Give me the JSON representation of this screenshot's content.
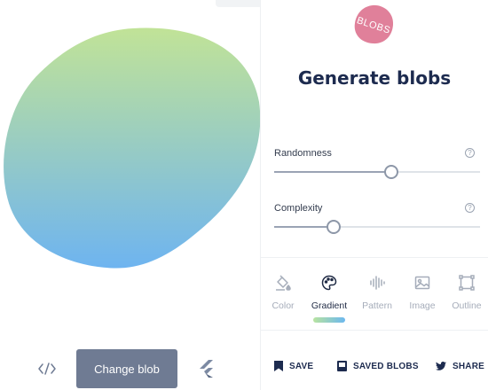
{
  "editor": {
    "blob": {
      "gradient_start": "#c1e397",
      "gradient_end": "#6eb4f0"
    },
    "code_icon_name": "code-icon",
    "change_blob_label": "Change blob",
    "flutter_icon_name": "flutter-icon"
  },
  "sidebar": {
    "logo_text": "BLOBS",
    "logo_color": "#e0809a",
    "title": "Generate blobs",
    "sliders": [
      {
        "label": "Randomness",
        "value_percent": 57
      },
      {
        "label": "Complexity",
        "value_percent": 29
      }
    ],
    "tabs": [
      {
        "label": "Color",
        "icon": "paint-bucket-icon",
        "active": false
      },
      {
        "label": "Gradient",
        "icon": "palette-icon",
        "active": true
      },
      {
        "label": "Pattern",
        "icon": "waveform-icon",
        "active": false
      },
      {
        "label": "Image",
        "icon": "image-icon",
        "active": false
      },
      {
        "label": "Outline",
        "icon": "outline-icon",
        "active": false
      }
    ],
    "actions": [
      {
        "label": "SAVE",
        "icon": "bookmark-icon"
      },
      {
        "label": "SAVED BLOBS",
        "icon": "saved-icon"
      },
      {
        "label": "SHARE",
        "icon": "twitter-icon"
      }
    ]
  }
}
